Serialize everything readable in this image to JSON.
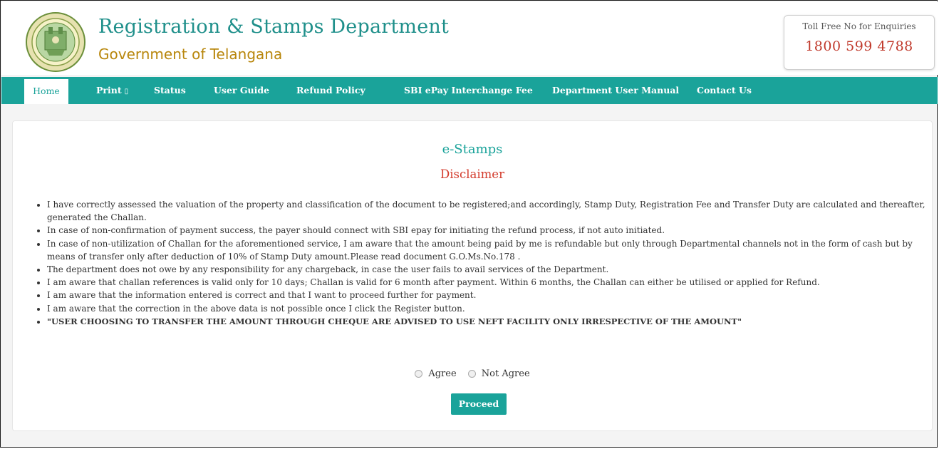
{
  "header": {
    "title": "Registration & Stamps Department",
    "subtitle": "Government of Telangana",
    "toll_free_label": "Toll Free No for Enquiries",
    "toll_free_number": "1800 599 4788"
  },
  "nav": {
    "items": [
      {
        "label": "Home",
        "active": true
      },
      {
        "label": "Print",
        "has_dropdown": true,
        "caret": "▯"
      },
      {
        "label": "Status"
      },
      {
        "label": "User Guide"
      },
      {
        "label": "Refund Policy"
      },
      {
        "label": "SBI ePay Interchange Fee"
      },
      {
        "label": "Department User Manual"
      },
      {
        "label": "Contact Us"
      }
    ]
  },
  "main": {
    "title": "e-Stamps",
    "subtitle": "Disclaimer",
    "disclaimer_items": [
      "I have correctly assessed the valuation of the property and classification of the document to be registered;and accordingly, Stamp Duty, Registration Fee and Transfer Duty are calculated and thereafter, generated the Challan.",
      "In case of non-confirmation of payment success, the payer should connect with SBI epay for initiating the refund process, if not auto initiated.",
      "In case of non-utilization of Challan for the aforementioned service, I am aware that the amount being paid by me is refundable but only through Departmental channels not in the form of cash but by means of transfer only after deduction of 10% of Stamp Duty amount.Please read document G.O.Ms.No.178 .",
      "The department does not owe by any responsibility for any chargeback, in case the user fails to avail services of the Department.",
      "I am aware that challan references is valid only for 10 days; Challan is valid for 6 month after payment. Within 6 months, the Challan can either be utilised or applied for Refund.",
      "I am aware that the information entered is correct and that I want to proceed further for payment.",
      "I am aware that the correction in the above data is not possible once I click the Register button.",
      "\"USER CHOOSING TO TRANSFER THE AMOUNT THROUGH CHEQUE ARE ADVISED TO USE NEFT FACILITY ONLY IRRESPECTIVE OF THE AMOUNT\""
    ],
    "agree_label": "Agree",
    "not_agree_label": "Not Agree",
    "proceed_label": "Proceed"
  },
  "colors": {
    "teal": "#1aa39a",
    "title_teal": "#1e8f8a",
    "red": "#d33b2c",
    "gold": "#b8860b"
  },
  "icons": {
    "emblem": "telangana-state-emblem"
  }
}
